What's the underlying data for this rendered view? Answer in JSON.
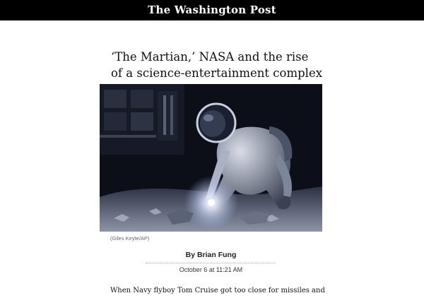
{
  "masthead": {
    "logo_text": "The Washington Post"
  },
  "article": {
    "headline": "‘The Martian,’ NASA and the rise of a science-entertainment complex",
    "photo_credit": "(Giles Keyte/AP)",
    "byline": "By Brian Fung",
    "timestamp": "October 6 at 11:21 AM",
    "body_first_line": "When Navy flyboy Tom Cruise got too close for missiles and"
  },
  "colors": {
    "masthead_bg": "#000000",
    "masthead_text": "#ffffff",
    "text": "#111111",
    "caption": "#666666"
  }
}
